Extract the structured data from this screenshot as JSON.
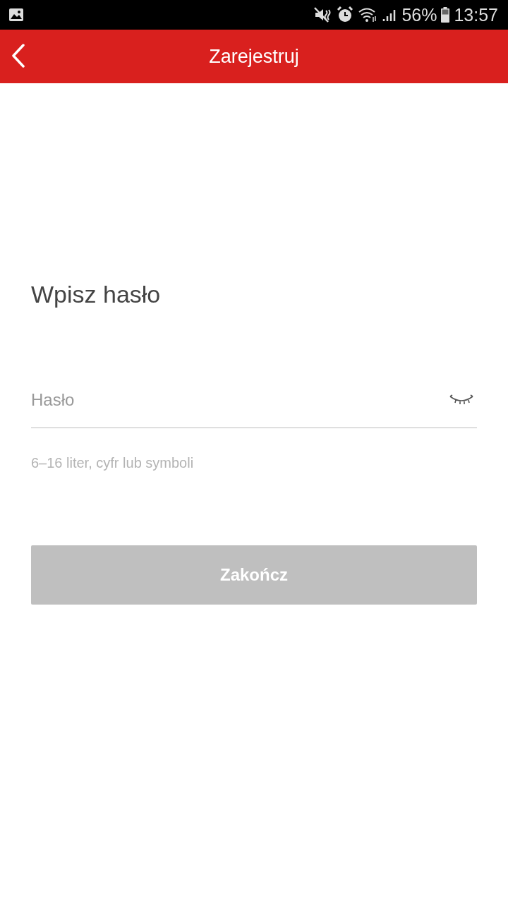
{
  "status_bar": {
    "battery": "56%",
    "time": "13:57"
  },
  "header": {
    "title": "Zarejestruj"
  },
  "heading": "Wpisz hasło",
  "password_field": {
    "placeholder": "Hasło",
    "password_visible": false
  },
  "hint": "6–16 liter, cyfr lub symboli",
  "submit_button": {
    "label": "Zakończ",
    "disabled": true
  }
}
